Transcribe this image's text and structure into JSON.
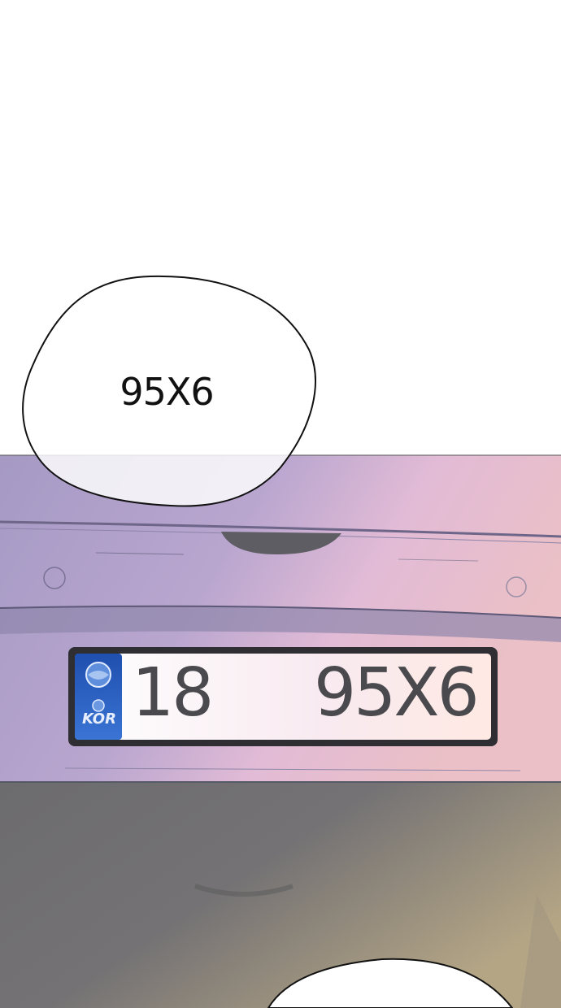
{
  "speech_bubble": {
    "text": "95X6"
  },
  "license_plate": {
    "region": "18",
    "number": "95X6",
    "country_code": "KOR"
  },
  "colors": {
    "background_top": "#ffffff",
    "car_body_left": "#a79bc4",
    "car_body_right": "#e2b6cc",
    "bumper_dark": "#6b6b6b",
    "plate_blue": "#2f5fc0"
  }
}
